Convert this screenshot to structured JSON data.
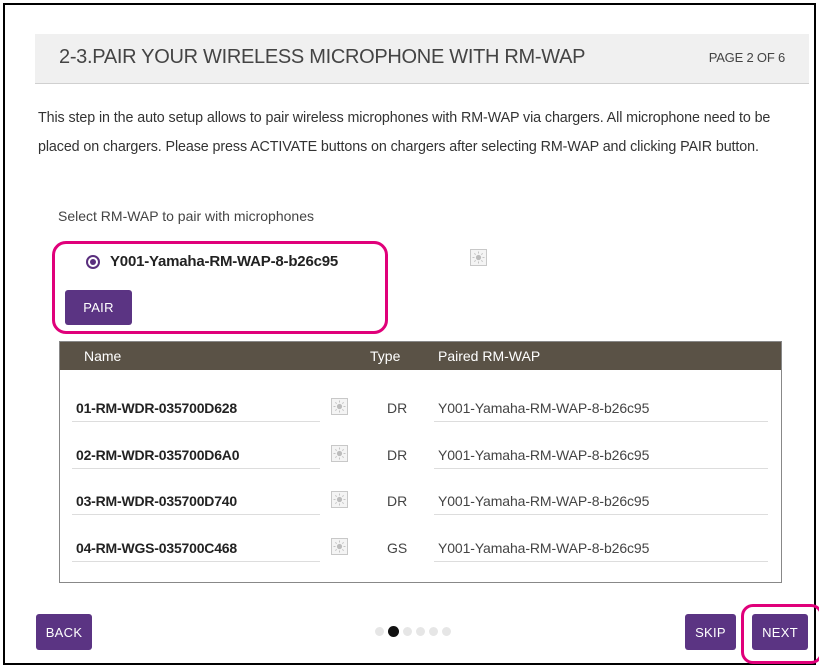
{
  "header": {
    "title": "2-3.PAIR YOUR WIRELESS MICROPHONE WITH RM-WAP",
    "page_indicator": "PAGE 2 OF 6"
  },
  "description": "This step in the auto setup allows to pair wireless microphones with RM-WAP via chargers. All microphone need to be placed on chargers. Please press ACTIVATE buttons on chargers after selecting RM-WAP and clicking PAIR button.",
  "select_label": "Select RM-WAP to pair with microphones",
  "access_point": {
    "label": "Y001-Yamaha-RM-WAP-8-b26c95",
    "selected": true,
    "icon": "indicator-led-icon"
  },
  "pair_button": "PAIR",
  "table": {
    "headers": {
      "name": "Name",
      "type": "Type",
      "paired": "Paired RM-WAP"
    },
    "rows": [
      {
        "name": "01-RM-WDR-035700D628",
        "type": "DR",
        "paired": "Y001-Yamaha-RM-WAP-8-b26c95"
      },
      {
        "name": "02-RM-WDR-035700D6A0",
        "type": "DR",
        "paired": "Y001-Yamaha-RM-WAP-8-b26c95"
      },
      {
        "name": "03-RM-WDR-035700D740",
        "type": "DR",
        "paired": "Y001-Yamaha-RM-WAP-8-b26c95"
      },
      {
        "name": "04-RM-WGS-035700C468",
        "type": "GS",
        "paired": "Y001-Yamaha-RM-WAP-8-b26c95"
      }
    ]
  },
  "pagination": {
    "total": 6,
    "current": 2
  },
  "buttons": {
    "back": "BACK",
    "skip": "SKIP",
    "next": "NEXT"
  },
  "colors": {
    "accent": "#5b3483",
    "highlight": "#e0007a",
    "table_header": "#5a5246"
  }
}
